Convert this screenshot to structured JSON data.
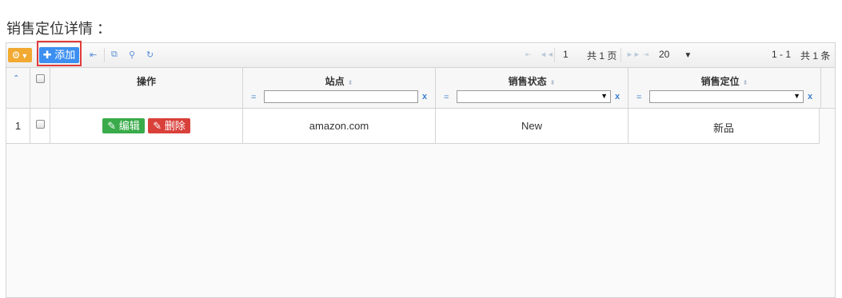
{
  "title": "销售定位详情 ：",
  "toolbar": {
    "add_label": "添加",
    "add_icon": "plus-icon",
    "settings_icon": "gear-icon",
    "icons": [
      "first-page-icon",
      "columns-icon",
      "search-icon",
      "refresh-icon"
    ]
  },
  "pager": {
    "page": "1",
    "total_pages_label": "共 1 页",
    "rows_per_page": "20",
    "range": "1 - 1",
    "total_label": "共 1 条"
  },
  "columns": {
    "action": "操作",
    "site": "站点",
    "status": "销售状态",
    "positioning": "销售定位"
  },
  "filter": {
    "eq": "=",
    "clear": "x"
  },
  "rows": [
    {
      "num": "1",
      "edit_label": "编辑",
      "delete_label": "删除",
      "site": "amazon.com",
      "status": "New",
      "positioning": "新品"
    }
  ],
  "colors": {
    "add_button": "#3c8ff0",
    "edit_button": "#3aab4a",
    "delete_button": "#d9403a",
    "settings_button": "#f2a931",
    "highlight": "#e03b3b"
  }
}
